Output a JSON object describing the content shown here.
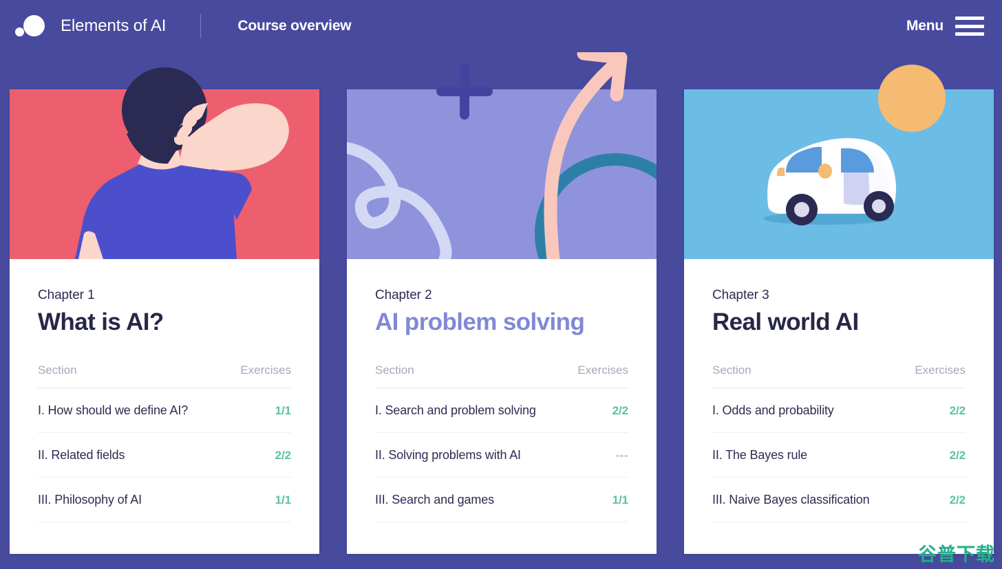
{
  "header": {
    "logo_name": "elements-of-ai-logo",
    "brand": "Elements of AI",
    "page_title": "Course overview",
    "menu_label": "Menu",
    "menu_icon": "hamburger-icon"
  },
  "colors": {
    "page_background": "#484a9e",
    "card_background": "#ffffff",
    "accent_green": "#5cc39b",
    "muted_gray": "#a7a7bb",
    "title_dark": "#272746",
    "title_periwinkle": "#8188d6",
    "card1_panel": "#ed5f6e",
    "card2_panel": "#8e93dc",
    "card3_panel": "#6cbde6",
    "watermark_green": "#23b08a"
  },
  "columns": {
    "section": "Section",
    "exercises": "Exercises"
  },
  "cards": [
    {
      "illustration": "person-scratching-head-illustration",
      "panel_color": "#ed5f6e",
      "chapter_label": "Chapter 1",
      "title": "What is AI?",
      "title_color": "#272746",
      "sections": [
        {
          "name": "I. How should we define AI?",
          "count": "1/1",
          "complete": true
        },
        {
          "name": "II. Related fields",
          "count": "2/2",
          "complete": true
        },
        {
          "name": "III. Philosophy of AI",
          "count": "1/1",
          "complete": true
        }
      ]
    },
    {
      "illustration": "abstract-shapes-arrow-illustration",
      "panel_color": "#8e93dc",
      "chapter_label": "Chapter 2",
      "title": "AI problem solving",
      "title_color": "#8188d6",
      "sections": [
        {
          "name": "I. Search and problem solving",
          "count": "2/2",
          "complete": true
        },
        {
          "name": "II. Solving problems with AI",
          "count": "---",
          "complete": false
        },
        {
          "name": "III. Search and games",
          "count": "1/1",
          "complete": true
        }
      ]
    },
    {
      "illustration": "self-driving-car-illustration",
      "panel_color": "#6cbde6",
      "chapter_label": "Chapter 3",
      "title": "Real world AI",
      "title_color": "#272746",
      "sections": [
        {
          "name": "I. Odds and probability",
          "count": "2/2",
          "complete": true
        },
        {
          "name": "II. The Bayes rule",
          "count": "2/2",
          "complete": true
        },
        {
          "name": "III. Naive Bayes classification",
          "count": "2/2",
          "complete": true
        }
      ]
    }
  ],
  "watermark": "谷普下载"
}
